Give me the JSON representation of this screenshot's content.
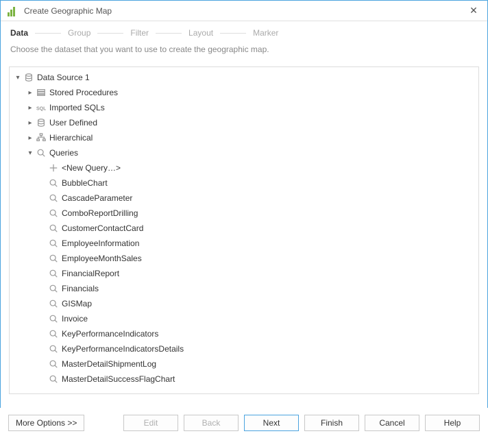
{
  "window": {
    "title": "Create Geographic Map"
  },
  "steps": {
    "items": [
      "Data",
      "Group",
      "Filter",
      "Layout",
      "Marker"
    ],
    "active_index": 0
  },
  "description": "Choose the dataset that you want to use to create the geographic map.",
  "tree": {
    "root": {
      "label": "Data Source 1",
      "expanded": true,
      "icon": "database-icon"
    },
    "children": [
      {
        "label": "Stored Procedures",
        "expanded": false,
        "icon": "proc-icon",
        "has_children": true
      },
      {
        "label": "Imported SQLs",
        "expanded": false,
        "icon": "sql-icon",
        "has_children": true
      },
      {
        "label": "User Defined",
        "expanded": false,
        "icon": "database-icon",
        "has_children": true
      },
      {
        "label": "Hierarchical",
        "expanded": false,
        "icon": "hier-icon",
        "has_children": true
      },
      {
        "label": "Queries",
        "expanded": true,
        "icon": "query-icon",
        "has_children": true
      }
    ],
    "queries": [
      {
        "label": "<New Query…>",
        "icon": "plus-icon"
      },
      {
        "label": "BubbleChart",
        "icon": "query-icon"
      },
      {
        "label": "CascadeParameter",
        "icon": "query-icon"
      },
      {
        "label": "ComboReportDrilling",
        "icon": "query-icon"
      },
      {
        "label": "CustomerContactCard",
        "icon": "query-icon"
      },
      {
        "label": "EmployeeInformation",
        "icon": "query-icon"
      },
      {
        "label": "EmployeeMonthSales",
        "icon": "query-icon"
      },
      {
        "label": "FinancialReport",
        "icon": "query-icon"
      },
      {
        "label": "Financials",
        "icon": "query-icon"
      },
      {
        "label": "GISMap",
        "icon": "query-icon"
      },
      {
        "label": "Invoice",
        "icon": "query-icon"
      },
      {
        "label": "KeyPerformanceIndicators",
        "icon": "query-icon"
      },
      {
        "label": "KeyPerformanceIndicatorsDetails",
        "icon": "query-icon"
      },
      {
        "label": "MasterDetailShipmentLog",
        "icon": "query-icon"
      },
      {
        "label": "MasterDetailSuccessFlagChart",
        "icon": "query-icon"
      }
    ]
  },
  "buttons": {
    "more": "More Options >>",
    "edit": "Edit",
    "back": "Back",
    "next": "Next",
    "finish": "Finish",
    "cancel": "Cancel",
    "help": "Help"
  }
}
